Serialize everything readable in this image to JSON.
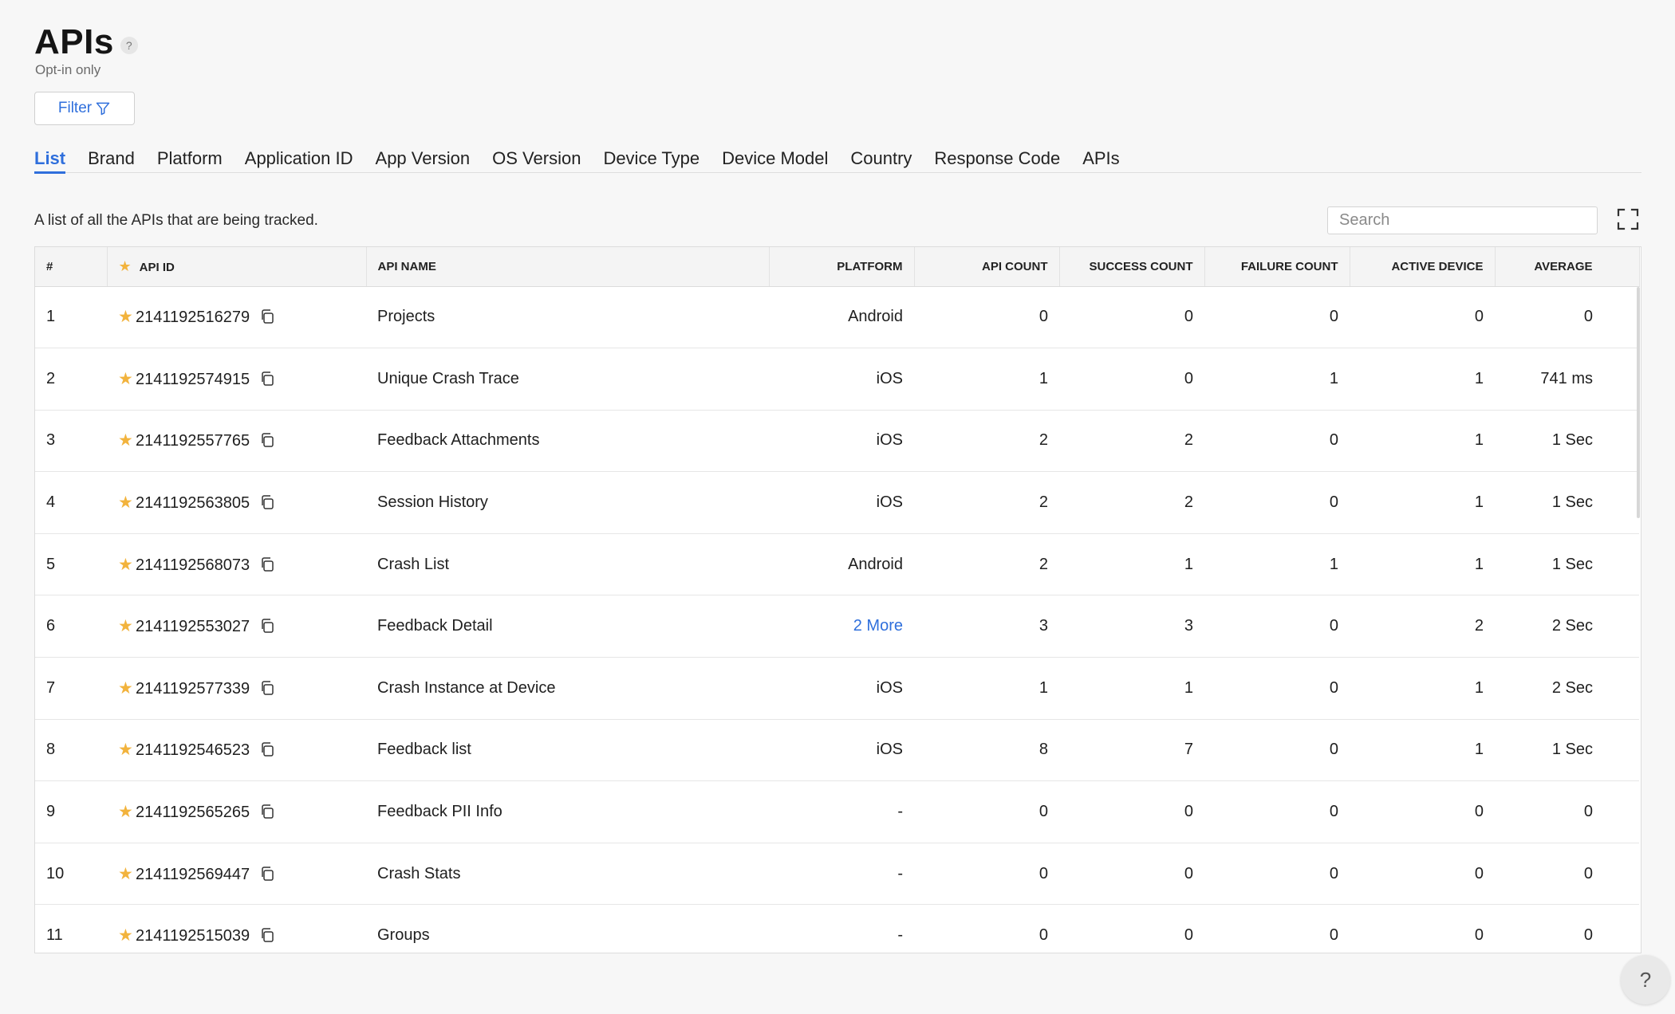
{
  "header": {
    "title": "APIs",
    "help_glyph": "?",
    "subtitle": "Opt-in only"
  },
  "filter": {
    "label": "Filter",
    "icon": "funnel-icon"
  },
  "tabs": [
    {
      "label": "List",
      "active": true
    },
    {
      "label": "Brand"
    },
    {
      "label": "Platform"
    },
    {
      "label": "Application ID"
    },
    {
      "label": "App Version"
    },
    {
      "label": "OS Version"
    },
    {
      "label": "Device Type"
    },
    {
      "label": "Device Model"
    },
    {
      "label": "Country"
    },
    {
      "label": "Response Code"
    },
    {
      "label": "APIs"
    }
  ],
  "description": "A list of all the APIs that are being tracked.",
  "search": {
    "placeholder": "Search"
  },
  "table": {
    "columns": {
      "index": "#",
      "api_id": "API ID",
      "api_name": "API NAME",
      "platform": "PLATFORM",
      "api_count": "API COUNT",
      "success_count": "SUCCESS COUNT",
      "failure_count": "FAILURE COUNT",
      "active_device": "ACTIVE DEVICE",
      "average": "AVERAGE"
    },
    "rows": [
      {
        "index": "1",
        "api_id": "2141192516279",
        "api_name": "Projects",
        "platform": "Android",
        "api_count": "0",
        "success_count": "0",
        "failure_count": "0",
        "active_device": "0",
        "average": "0"
      },
      {
        "index": "2",
        "api_id": "2141192574915",
        "api_name": "Unique Crash Trace",
        "platform": "iOS",
        "api_count": "1",
        "success_count": "0",
        "failure_count": "1",
        "active_device": "1",
        "average": "741 ms"
      },
      {
        "index": "3",
        "api_id": "2141192557765",
        "api_name": "Feedback Attachments",
        "platform": "iOS",
        "api_count": "2",
        "success_count": "2",
        "failure_count": "0",
        "active_device": "1",
        "average": "1 Sec"
      },
      {
        "index": "4",
        "api_id": "2141192563805",
        "api_name": "Session History",
        "platform": "iOS",
        "api_count": "2",
        "success_count": "2",
        "failure_count": "0",
        "active_device": "1",
        "average": "1 Sec"
      },
      {
        "index": "5",
        "api_id": "2141192568073",
        "api_name": "Crash List",
        "platform": "Android",
        "api_count": "2",
        "success_count": "1",
        "failure_count": "1",
        "active_device": "1",
        "average": "1 Sec"
      },
      {
        "index": "6",
        "api_id": "2141192553027",
        "api_name": "Feedback Detail",
        "platform": "2 More",
        "platform_is_link": true,
        "api_count": "3",
        "success_count": "3",
        "failure_count": "0",
        "active_device": "2",
        "average": "2 Sec"
      },
      {
        "index": "7",
        "api_id": "2141192577339",
        "api_name": "Crash Instance at Device",
        "platform": "iOS",
        "api_count": "1",
        "success_count": "1",
        "failure_count": "0",
        "active_device": "1",
        "average": "2 Sec"
      },
      {
        "index": "8",
        "api_id": "2141192546523",
        "api_name": "Feedback list",
        "platform": "iOS",
        "api_count": "8",
        "success_count": "7",
        "failure_count": "0",
        "active_device": "1",
        "average": "1 Sec"
      },
      {
        "index": "9",
        "api_id": "2141192565265",
        "api_name": "Feedback PII Info",
        "platform": "-",
        "api_count": "0",
        "success_count": "0",
        "failure_count": "0",
        "active_device": "0",
        "average": "0"
      },
      {
        "index": "10",
        "api_id": "2141192569447",
        "api_name": "Crash Stats",
        "platform": "-",
        "api_count": "0",
        "success_count": "0",
        "failure_count": "0",
        "active_device": "0",
        "average": "0"
      },
      {
        "index": "11",
        "api_id": "2141192515039",
        "api_name": "Groups",
        "platform": "-",
        "api_count": "0",
        "success_count": "0",
        "failure_count": "0",
        "active_device": "0",
        "average": "0"
      }
    ]
  },
  "colors": {
    "accent": "#2f6fdc",
    "star": "#f2b33d"
  },
  "help_fab": {
    "glyph": "?"
  }
}
